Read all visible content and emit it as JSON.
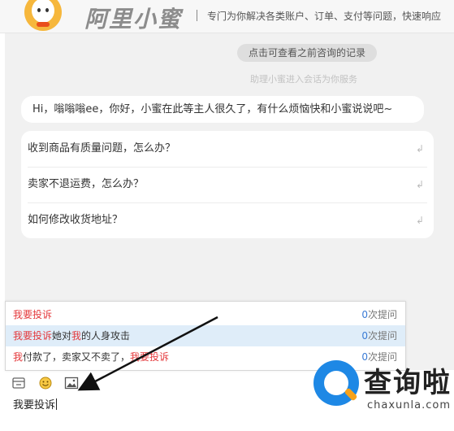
{
  "header": {
    "brand": "阿里小蜜",
    "slogan": "专门为你解决各类账户、订单、支付等问题，快速响应"
  },
  "chat": {
    "history_button": "点击可查看之前咨询的记录",
    "service_note": "助理小蜜进入会话为你服务",
    "greeting": "Hi，嗡嗡嗡ee，你好，小蜜在此等主人很久了，有什么烦恼快和小蜜说说吧~",
    "faq": [
      {
        "question": "收到商品有质量问题，怎么办？"
      },
      {
        "question": "卖家不退运费，怎么办？"
      },
      {
        "question": "如何修改收货地址？"
      }
    ]
  },
  "suggestions": [
    {
      "parts": [
        {
          "text": "我要投诉",
          "highlight": true
        }
      ],
      "count": "0",
      "count_suffix": "次提问"
    },
    {
      "parts": [
        {
          "text": "我要投诉",
          "highlight": true
        },
        {
          "text": "她对",
          "highlight": false
        },
        {
          "text": "我",
          "highlight": true
        },
        {
          "text": "的人身攻击",
          "highlight": false
        }
      ],
      "count": "0",
      "count_suffix": "次提问"
    },
    {
      "parts": [
        {
          "text": "我",
          "highlight": true
        },
        {
          "text": "付款了，卖家又不卖了，",
          "highlight": false
        },
        {
          "text": "我要投诉",
          "highlight": true
        }
      ],
      "count": "0",
      "count_suffix": "次提问"
    }
  ],
  "composer": {
    "input_value": "我要投诉"
  },
  "toolbar": {
    "icons": [
      "card-icon",
      "emoji-icon",
      "image-icon"
    ]
  },
  "watermark": {
    "cn": "查询啦",
    "en": "chaxunla.com"
  },
  "colors": {
    "highlight": "#e4393c",
    "count": "#3a7bd5",
    "selected_row": "#dfedf9",
    "chat_bg": "#f1f1f1"
  }
}
